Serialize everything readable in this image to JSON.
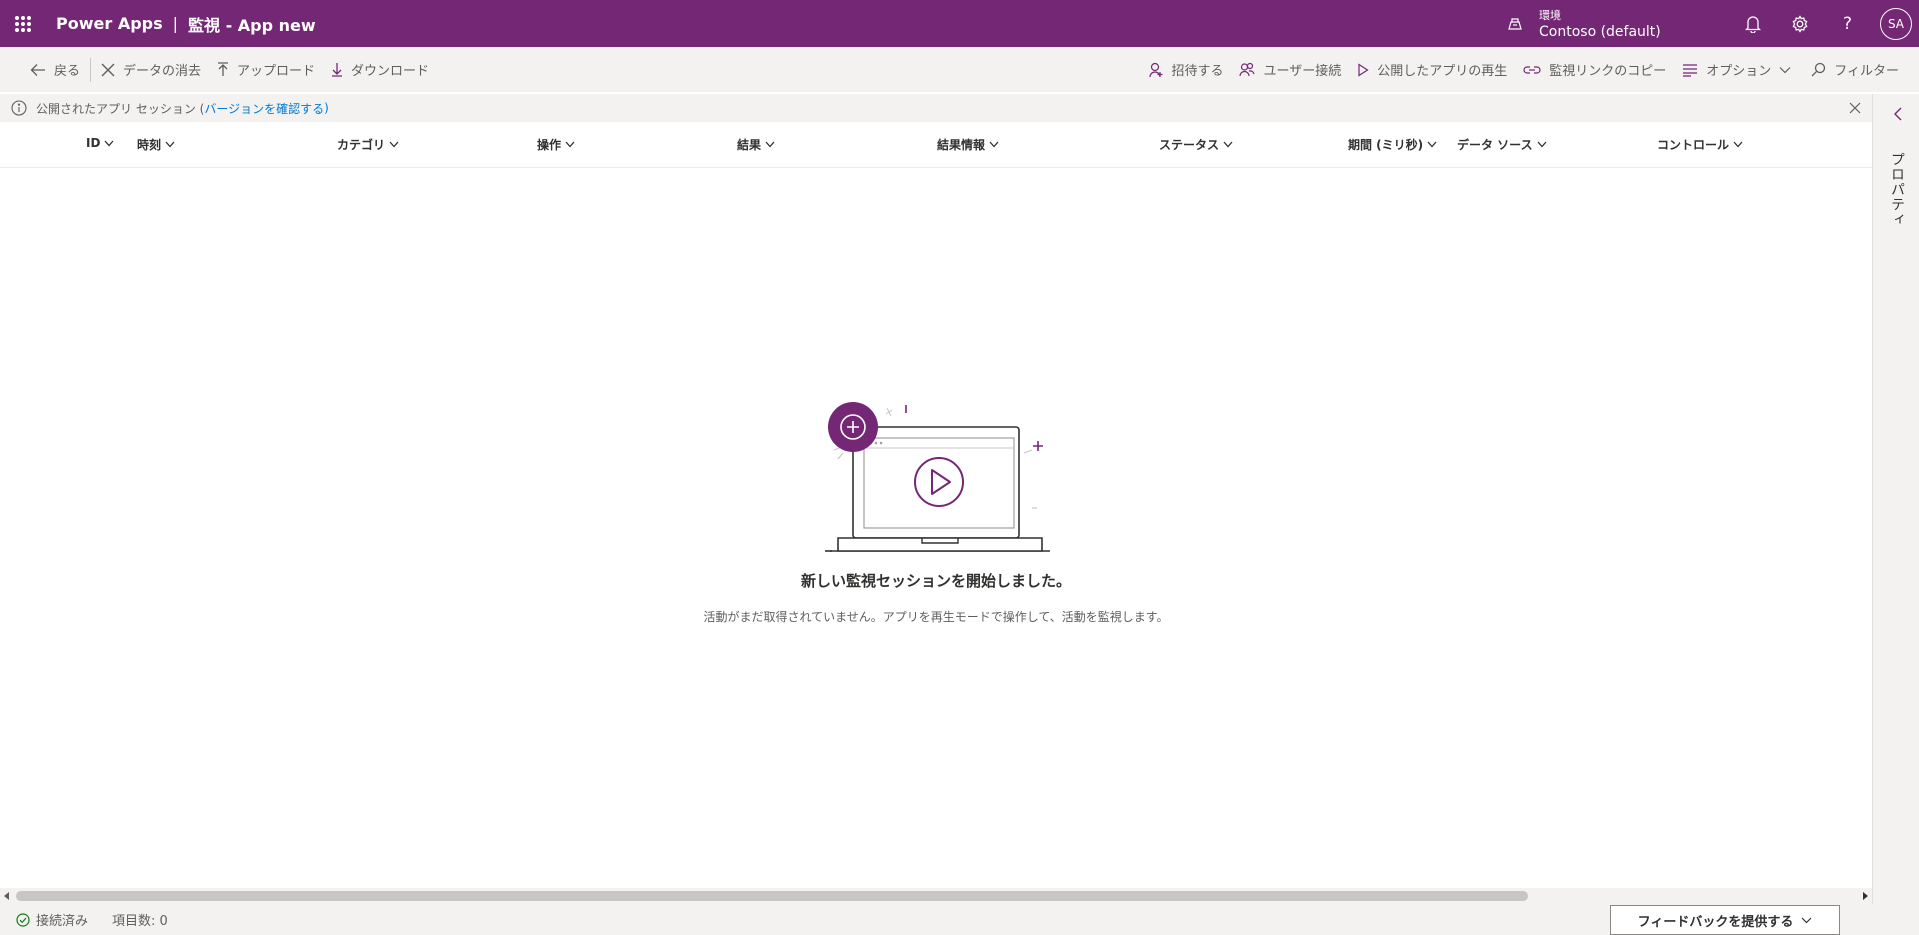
{
  "header": {
    "brand": "Power Apps",
    "separator": "|",
    "title": "監視 - App new",
    "environment_label": "環境",
    "environment_name": "Contoso (default)",
    "avatar_initials": "SA",
    "icons": [
      "waffle-icon",
      "environment-icon",
      "bell-icon",
      "gear-icon",
      "help-icon"
    ],
    "brand_color": "#742774"
  },
  "commands": {
    "back": "戻る",
    "clear": "データの消去",
    "upload": "アップロード",
    "download": "ダウンロード",
    "invite": "招待する",
    "user_connect": "ユーザー接続",
    "play_published": "公開したアプリの再生",
    "copy_link": "監視リンクのコピー",
    "options": "オプション",
    "filter": "フィルター"
  },
  "infobar": {
    "text": "公開されたアプリ セッション (",
    "link": "バージョンを確認する",
    "text_end": ")"
  },
  "table": {
    "columns": [
      "ID",
      "時刻",
      "カテゴリ",
      "操作",
      "結果",
      "結果情報",
      "ステータス",
      "期間 (ミリ秒)",
      "データ ソース",
      "コントロール"
    ]
  },
  "empty_state": {
    "title": "新しい監視セッションを開始しました。",
    "subtitle": "活動がまだ取得されていません。アプリを再生モードで操作して、活動を監視します。"
  },
  "right_panel": {
    "label": "プロパティ"
  },
  "status": {
    "connected": "接続済み",
    "item_count": "項目数: 0",
    "feedback": "フィードバックを提供する"
  }
}
